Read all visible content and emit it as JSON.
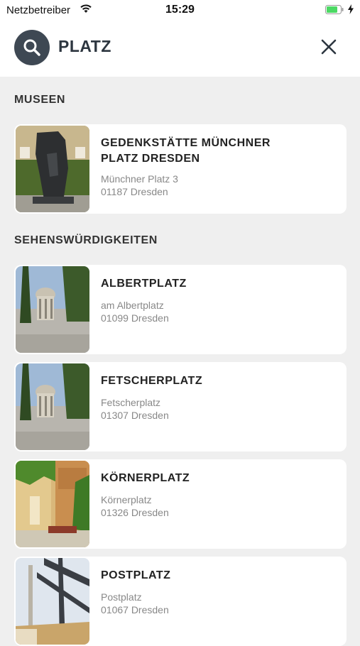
{
  "status_bar": {
    "carrier": "Netzbetreiber",
    "time": "15:29",
    "wifi_icon": "wifi-icon",
    "battery_icon": "battery-icon",
    "battery_level": 0.7,
    "battery_color": "#4cd964"
  },
  "search": {
    "query": "PLATZ",
    "search_icon": "search-icon",
    "close_icon": "close-icon"
  },
  "sections": [
    {
      "title": "MUSEEN",
      "items": [
        {
          "title_line1": "GEDENKSTÄTTE MÜNCHNER",
          "title_line2": "PLATZ DRESDEN",
          "street": "Münchner Platz 3",
          "city": "01187 Dresden"
        }
      ]
    },
    {
      "title": "SEHENSWÜRDIGKEITEN",
      "items": [
        {
          "title_line1": "ALBERTPLATZ",
          "street": "am Albertplatz",
          "city": "01099 Dresden"
        },
        {
          "title_line1": "FETSCHERPLATZ",
          "street": "Fetscherplatz",
          "city": "01307 Dresden"
        },
        {
          "title_line1": "KÖRNERPLATZ",
          "street": "Körnerplatz",
          "city": "01326 Dresden"
        },
        {
          "title_line1": "POSTPLATZ",
          "street": "Postplatz",
          "city": "01067 Dresden"
        }
      ]
    }
  ]
}
